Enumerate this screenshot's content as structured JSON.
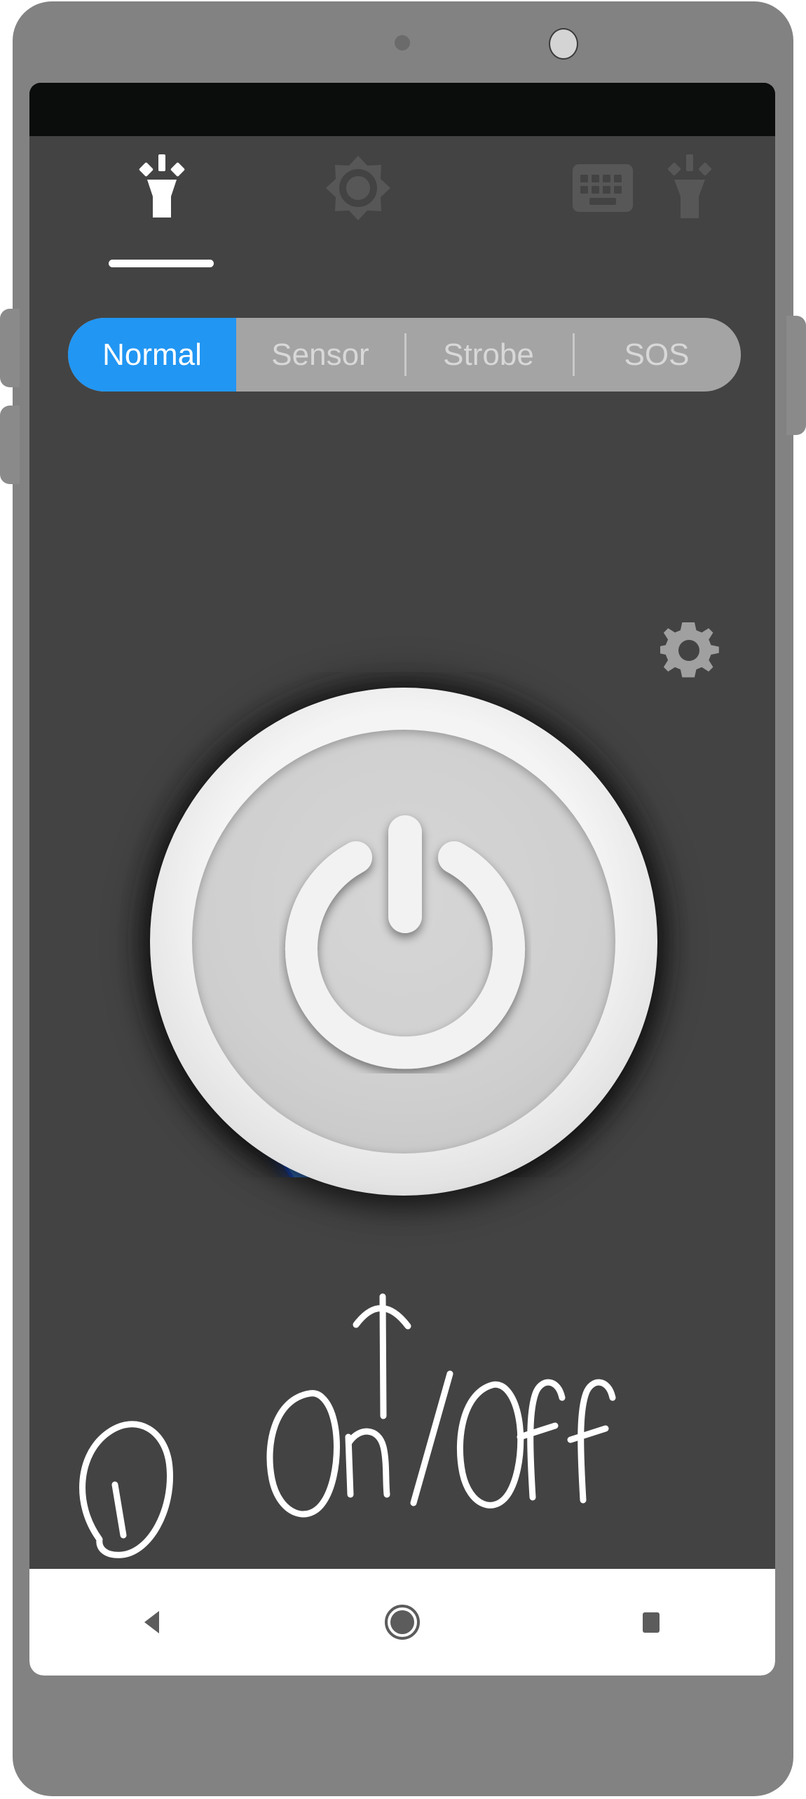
{
  "device": {
    "name": "android-phone-mockup",
    "frame_color": "#828282",
    "screen_bg": "#434343",
    "status_bar_color": "#0b0c0c",
    "buttons": {
      "volume_up": "Volume Up",
      "volume_down": "Volume Down",
      "power": "Power"
    },
    "front_camera_label": "Front Camera",
    "earpiece_label": "Proximity Sensor"
  },
  "app": {
    "name": "Flashlight",
    "toolbar": {
      "items": [
        {
          "icon": "flashlight-icon",
          "label": "Flashlight",
          "selected": true
        },
        {
          "icon": "brightness-icon",
          "label": "Screen Light",
          "selected": false
        },
        {
          "icon": "keyboard-icon",
          "label": "Keyboard Light",
          "selected": false
        },
        {
          "icon": "flashlight-alt-icon",
          "label": "Torch",
          "selected": false
        }
      ],
      "active_index": 0,
      "active_color": "#ffffff",
      "inactive_color": "#5a5a5a"
    },
    "modes": {
      "tabs": [
        {
          "label": "Normal",
          "selected": true
        },
        {
          "label": "Sensor",
          "selected": false
        },
        {
          "label": "Strobe",
          "selected": false
        },
        {
          "label": "SOS",
          "selected": false
        }
      ],
      "selected": "Normal",
      "track_color": "#a4a4a4",
      "active_color": "#2196f3",
      "active_text_color": "#ffffff",
      "inactive_text_color": "#d8d8d8"
    },
    "settings_button": {
      "icon": "gear-icon",
      "label": "Settings",
      "color": "#a0a0a0"
    },
    "dial": {
      "blue_arc_color": "#3a7fd5",
      "blue_arc_glow_color": "#1a4fd0",
      "blue_arc_inner_color": "#6f9fc9",
      "handle_color": "#ddeeff",
      "yellow_arc_color": "#f5b800",
      "power_button_label": "Power",
      "power_icon": "power-icon"
    },
    "annotations": {
      "marker_label": "1",
      "callout_text": "On/Off",
      "arrow": "up-arrow",
      "ink_color": "#ffffff"
    }
  },
  "navigation": {
    "back": "Back",
    "home": "Home",
    "recents": "Recent Apps",
    "bar_color": "#ffffff",
    "icon_color": "#5c5c5c"
  }
}
